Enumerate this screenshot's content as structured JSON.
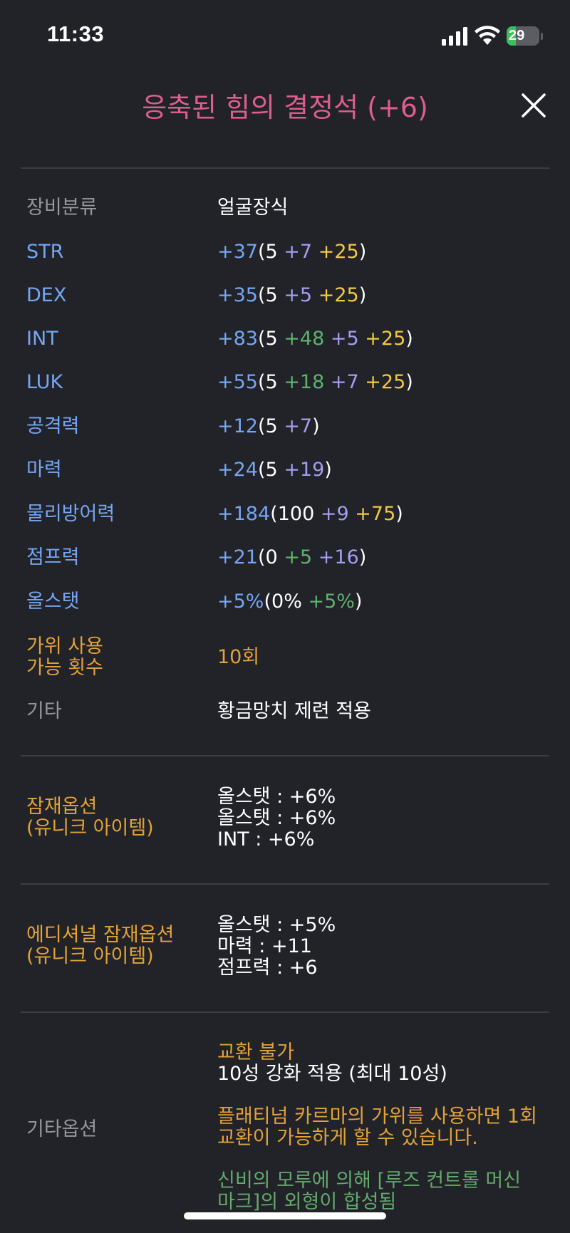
{
  "status_bar": {
    "time": "11:33",
    "battery_percent": 29,
    "battery_label": "29"
  },
  "header": {
    "title": "응축된 힘의 결정석 (+6)"
  },
  "stats": {
    "category_label": "장비분류",
    "category_value": "얼굴장식",
    "str": {
      "label": "STR",
      "total": "+37",
      "base": "5",
      "p2": "+7",
      "p3": "+25"
    },
    "dex": {
      "label": "DEX",
      "total": "+35",
      "base": "5",
      "p2": "+5",
      "p3": "+25"
    },
    "int": {
      "label": "INT",
      "total": "+83",
      "base": "5",
      "p1": "+48",
      "p2": "+5",
      "p3": "+25"
    },
    "luk": {
      "label": "LUK",
      "total": "+55",
      "base": "5",
      "p1": "+18",
      "p2": "+7",
      "p3": "+25"
    },
    "atk": {
      "label": "공격력",
      "total": "+12",
      "base": "5",
      "p2": "+7"
    },
    "matk": {
      "label": "마력",
      "total": "+24",
      "base": "5",
      "p2": "+19"
    },
    "def": {
      "label": "물리방어력",
      "total": "+184",
      "base": "100",
      "p2": "+9",
      "p3": "+75"
    },
    "jump": {
      "label": "점프력",
      "total": "+21",
      "base": "0",
      "p1": "+5",
      "p2": "+16"
    },
    "allstat": {
      "label": "올스탯",
      "total": "+5%",
      "base": "0%",
      "p1": "+5%"
    },
    "scissors_label_1": "가위 사용",
    "scissors_label_2": "가능 횟수",
    "scissors_value": "10회",
    "etc_label": "기타",
    "etc_value": "황금망치 제련 적용"
  },
  "potential": {
    "label_1": "잠재옵션",
    "label_2": "(유니크 아이템)",
    "lines": [
      "올스탯 : +6%",
      "올스탯 : +6%",
      "INT : +6%"
    ]
  },
  "additional_potential": {
    "label_1": "에디셔널 잠재옵션",
    "label_2": "(유니크 아이템)",
    "lines": [
      "올스탯 : +5%",
      "마력 : +11",
      "점프력 : +6"
    ]
  },
  "other_options": {
    "label": "기타옵션",
    "trade": "교환 불가",
    "starforce": "10성 강화 적용 (최대 10성)",
    "karma_1": "플래티넘 카르마의 가위를 사용하면 1회",
    "karma_2": "교환이 가능하게 할 수 있습니다.",
    "fusion_1": "신비의 모루에 의해 [루즈 컨트롤 머신",
    "fusion_2": "마크]의 외형이 합성됨"
  },
  "colors": {
    "background": "#222329",
    "title": "#dc5e8c",
    "stat_label": "#74a6f2",
    "scroll_bonus": "#a39df2",
    "starforce_bonus": "#f1ca3f",
    "flame_bonus": "#5fb26a",
    "potential_label": "#e2a236"
  }
}
